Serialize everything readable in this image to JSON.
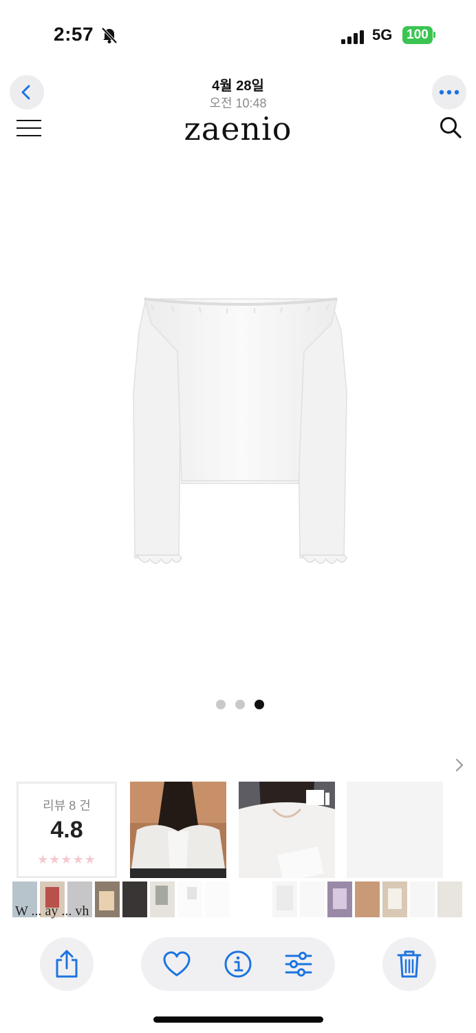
{
  "status_bar": {
    "time": "2:57",
    "network": "5G",
    "battery": "100"
  },
  "header": {
    "date": "4월 28일",
    "time": "오전 10:48"
  },
  "shop": {
    "brand": "zaenio"
  },
  "carousel": {
    "pages": 3,
    "active_index": 2
  },
  "reviews": {
    "count_label": "리뷰 8 건",
    "score": "4.8",
    "stars": "★★★★★"
  },
  "filmstrip": {
    "caption": "W ... ay ... vh"
  },
  "colors": {
    "accent": "#1c74e0",
    "battery": "#3cc452"
  },
  "icons": [
    "back-icon",
    "more-icon",
    "menu-icon",
    "search-icon",
    "chevron-right-icon",
    "share-icon",
    "heart-icon",
    "info-icon",
    "adjust-icon",
    "trash-icon"
  ]
}
